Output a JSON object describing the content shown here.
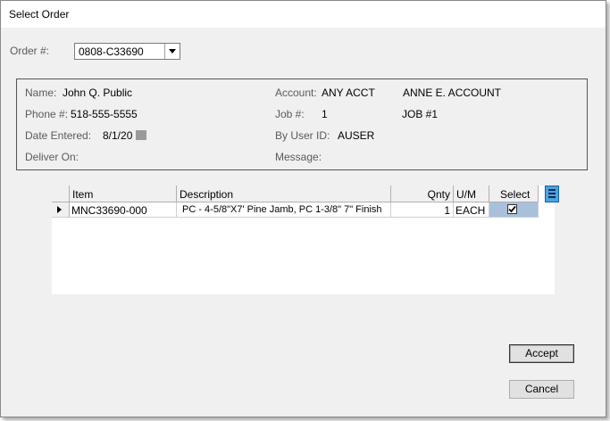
{
  "window": {
    "title": "Select Order"
  },
  "order": {
    "label": "Order #:",
    "value": "0808-C33690"
  },
  "info": {
    "name_label": "Name:",
    "name_value": "John Q. Public",
    "phone_label": "Phone #:",
    "phone_value": "518-555-5555",
    "date_label": "Date Entered:",
    "date_value": "8/1/20",
    "deliver_label": "Deliver On:",
    "deliver_value": "",
    "account_label": "Account:",
    "account_value": "ANY ACCT",
    "account_name": "ANNE E. ACCOUNT",
    "job_label": "Job #:",
    "job_value": "1",
    "job_name": "JOB #1",
    "user_label": "By User ID:",
    "user_value": "AUSER",
    "message_label": "Message:",
    "message_value": ""
  },
  "grid": {
    "columns": [
      "Item",
      "Description",
      "Qnty",
      "U/M",
      "Select"
    ],
    "rows": [
      {
        "item": "MNC33690-000",
        "description": "PC - 4-5/8\"X7' Pine Jamb, PC 1-3/8\" 7\" Finish",
        "qnty": "1",
        "um": "EACH",
        "selected": true
      }
    ]
  },
  "buttons": {
    "accept": "Accept",
    "cancel": "Cancel"
  },
  "colors": {
    "accent": "#4aa3e0",
    "selected_cell": "#a8c0dc"
  }
}
